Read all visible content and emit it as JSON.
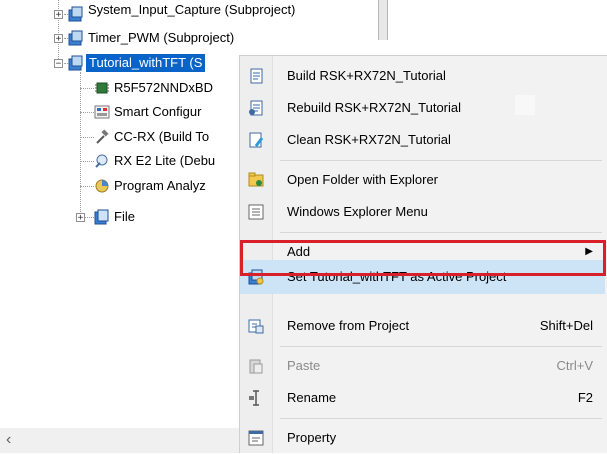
{
  "tree": {
    "items": [
      {
        "label": "System_Input_Capture (Subproject)",
        "expander": "+"
      },
      {
        "label": "Timer_PWM (Subproject)",
        "expander": "+"
      },
      {
        "label": "Tutorial_withTFT (S",
        "expander": "−"
      },
      {
        "label": "R5F572NNDxBD"
      },
      {
        "label": "Smart Configur"
      },
      {
        "label": "CC-RX (Build To"
      },
      {
        "label": "RX E2 Lite (Debu"
      },
      {
        "label": "Program Analyz"
      },
      {
        "label": "File",
        "expander": "+"
      }
    ],
    "scroll_left_glyph": "‹"
  },
  "menu": {
    "items": [
      {
        "label": "Build RSK+RX72N_Tutorial",
        "icon": "build-icon"
      },
      {
        "label": "Rebuild RSK+RX72N_Tutorial",
        "icon": "rebuild-icon"
      },
      {
        "label": "Clean RSK+RX72N_Tutorial",
        "icon": "clean-icon"
      },
      {
        "label": "Open Folder with Explorer",
        "icon": "folder-explorer-icon"
      },
      {
        "label": "Windows Explorer Menu",
        "icon": "explorer-menu-icon"
      },
      {
        "label": "Add",
        "submenu_arrow": "▶"
      },
      {
        "label": "Set Tutorial_withTFT as Active Project",
        "icon": "active-project-icon"
      },
      {
        "label": "Remove from Project",
        "shortcut": "Shift+Del",
        "icon": "remove-icon"
      },
      {
        "label": "Paste",
        "shortcut": "Ctrl+V",
        "icon": "paste-icon",
        "disabled": true
      },
      {
        "label": "Rename",
        "shortcut": "F2",
        "icon": "rename-icon"
      },
      {
        "label": "Property",
        "icon": "property-icon"
      }
    ]
  },
  "colors": {
    "highlight_fill": "#cde4f7",
    "annotation_border": "#d9202a",
    "selection": "#0a64c8"
  }
}
